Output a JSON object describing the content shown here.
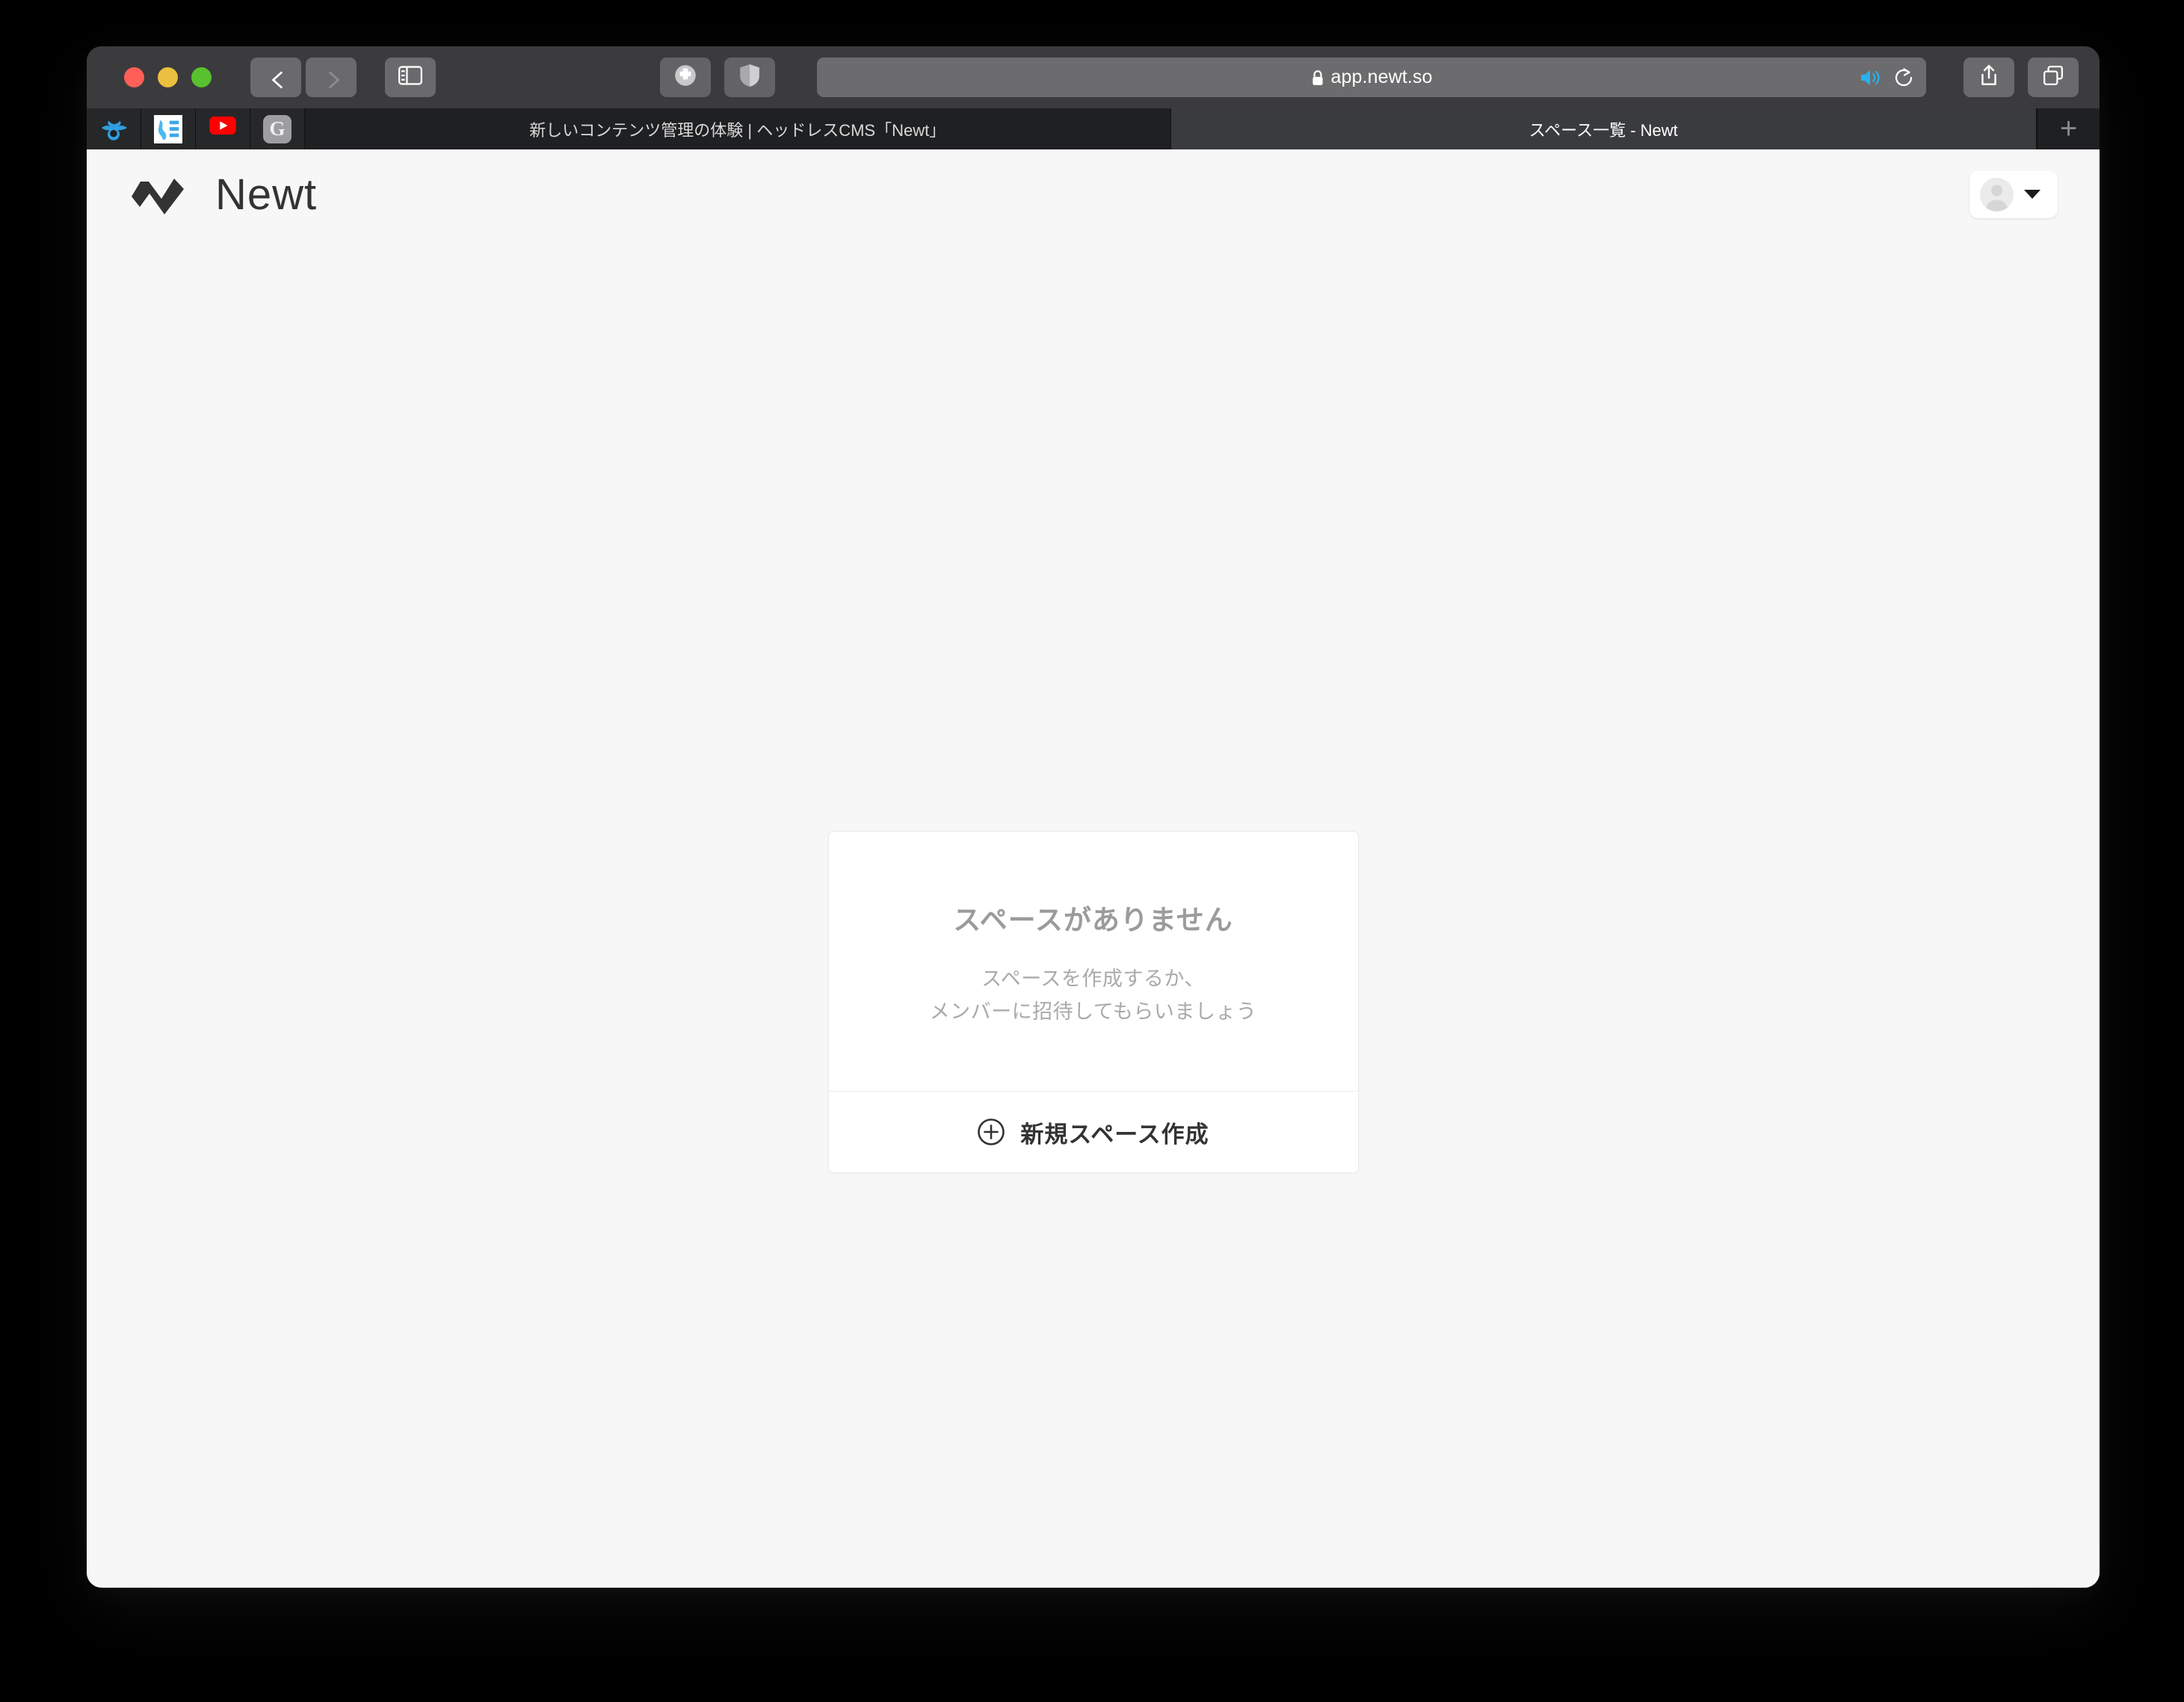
{
  "browser": {
    "window_controls": [
      {
        "name": "close",
        "color": "#ff5f57"
      },
      {
        "name": "minimize",
        "color": "#ebbf40"
      },
      {
        "name": "zoom",
        "color": "#57c22d"
      }
    ],
    "nav": {
      "back_label": "Back",
      "forward_label": "Forward",
      "sidebar_label": "Sidebar"
    },
    "extensions": [
      {
        "name": "extension-icon",
        "label": "Extension"
      },
      {
        "name": "shield-icon",
        "label": "Privacy Report"
      }
    ],
    "address": {
      "url": "app.newt.so",
      "secure": true,
      "lock_icon": "lock-icon",
      "audio_icon": "speaker-icon",
      "audio_color": "#2ab0f0",
      "reload_icon": "reload-icon"
    },
    "actions": [
      {
        "name": "share-icon",
        "label": "Share"
      },
      {
        "name": "tab-overview-icon",
        "label": "Tab Overview"
      }
    ],
    "pinned_tabs": [
      {
        "name": "pinned-tab-winged",
        "icon": "winged-circle-icon",
        "color": "#2f9fe0"
      },
      {
        "name": "pinned-tab-corona-map",
        "icon": "japan-map-icon",
        "color": "#4db8f0"
      },
      {
        "name": "pinned-tab-youtube",
        "icon": "youtube-icon",
        "color": "#ff0000"
      },
      {
        "name": "pinned-tab-g",
        "icon": "g-icon",
        "label": "G",
        "color": "#9e9ea2"
      }
    ],
    "tabs": [
      {
        "title": "新しいコンテンツ管理の体験 | ヘッドレスCMS「Newt」",
        "active": false
      },
      {
        "title": "スペース一覧 - Newt",
        "active": true
      }
    ],
    "new_tab_label": "+"
  },
  "app": {
    "brand": {
      "name": "Newt",
      "mark": "newt-logo-mark",
      "color": "#333333"
    },
    "account": {
      "avatar": "user-avatar-icon",
      "caret": "chevron-down-icon"
    },
    "empty_state": {
      "title": "スペースがありません",
      "description_line1": "スペースを作成するか、",
      "description_line2": "メンバーに招待してもらいましょう",
      "action_label": "新規スペース作成",
      "action_icon": "plus-circle-icon",
      "title_color": "#9b9b9b",
      "description_color": "#aaaaaa",
      "action_color": "#333333"
    }
  }
}
